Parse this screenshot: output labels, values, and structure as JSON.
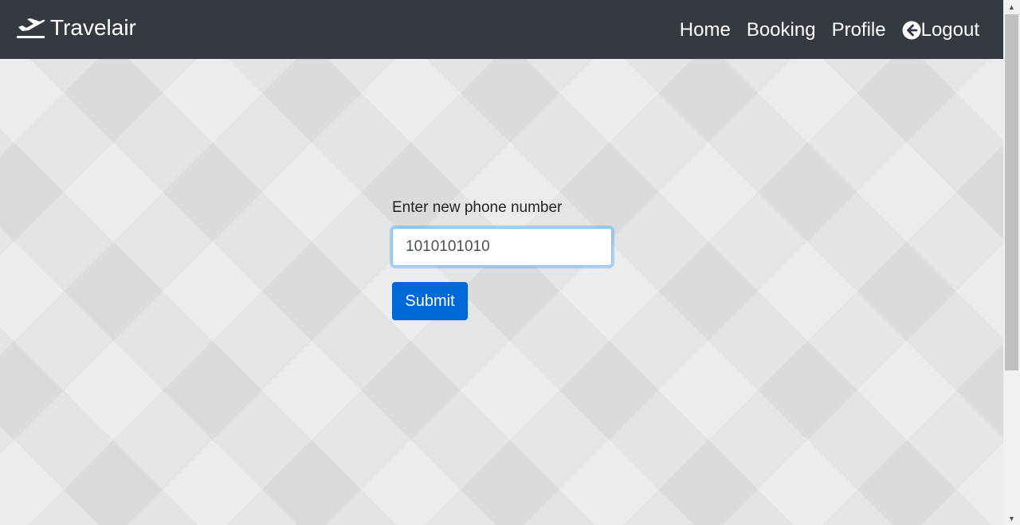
{
  "navbar": {
    "brand": "Travelair",
    "brand_icon": "plane-departure-icon",
    "links": {
      "home": "Home",
      "booking": "Booking",
      "profile": "Profile",
      "logout": "Logout"
    },
    "logout_icon": "arrow-circle-left-icon",
    "background": "#343a40"
  },
  "form": {
    "label": "Enter new phone number",
    "phone_value": "1010101010",
    "submit_label": "Submit",
    "accent": "#0069d9"
  }
}
